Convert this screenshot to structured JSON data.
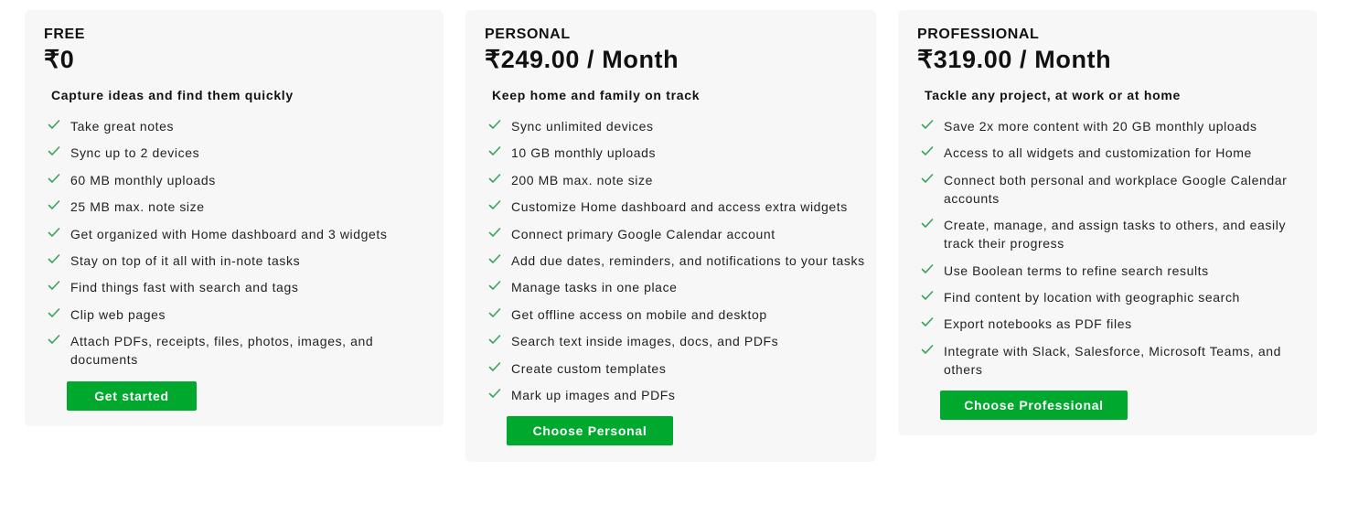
{
  "colors": {
    "accent": "#00a82d",
    "card_background": "#f7f7f7",
    "check": "#3aa35a"
  },
  "icons": {
    "feature_check": "check-icon"
  },
  "plans": [
    {
      "name": "FREE",
      "price": "₹0",
      "tagline": "Capture ideas and find them quickly",
      "features": [
        "Take great notes",
        "Sync up to 2 devices",
        "60 MB monthly uploads",
        "25 MB max. note size",
        "Get organized with Home dashboard and 3 widgets",
        "Stay on top of it all with in-note tasks",
        "Find things fast with search and tags",
        "Clip web pages",
        "Attach PDFs, receipts, files, photos, images, and documents"
      ],
      "cta": "Get started"
    },
    {
      "name": "PERSONAL",
      "price": "₹249.00 / Month",
      "tagline": "Keep home and family on track",
      "features": [
        "Sync unlimited devices",
        "10 GB monthly uploads",
        "200 MB max. note size",
        "Customize Home dashboard and access extra widgets",
        "Connect primary Google Calendar account",
        "Add due dates, reminders, and notifications to your tasks",
        "Manage tasks in one place",
        "Get offline access on mobile and desktop",
        "Search text inside images, docs, and PDFs",
        "Create custom templates",
        "Mark up images and PDFs"
      ],
      "cta": "Choose Personal"
    },
    {
      "name": "PROFESSIONAL",
      "price": "₹319.00 / Month",
      "tagline": "Tackle any project, at work or at home",
      "features": [
        "Save 2x more content with 20 GB monthly uploads",
        "Access to all widgets and customization for Home",
        "Connect both personal and workplace Google Calendar accounts",
        "Create, manage, and assign tasks to others, and easily track their progress",
        "Use Boolean terms to refine search results",
        "Find content by location with geographic search",
        "Export notebooks as PDF files",
        "Integrate with Slack, Salesforce, Microsoft Teams, and others"
      ],
      "cta": "Choose Professional"
    }
  ]
}
